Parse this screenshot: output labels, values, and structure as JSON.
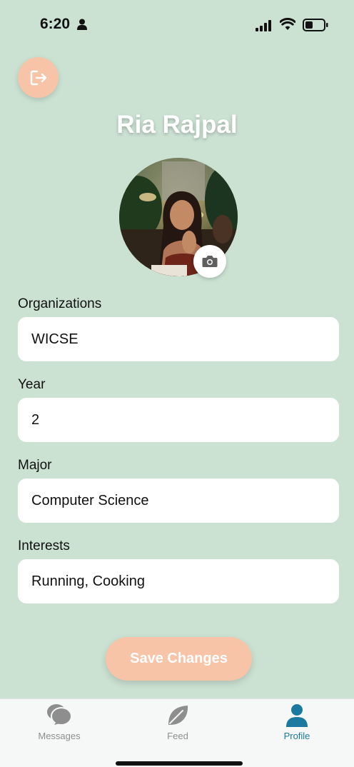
{
  "status_bar": {
    "time": "6:20"
  },
  "profile": {
    "name": "Ria Rajpal"
  },
  "fields": [
    {
      "label": "Organizations",
      "value": "WICSE"
    },
    {
      "label": "Year",
      "value": "2"
    },
    {
      "label": "Major",
      "value": "Computer Science"
    },
    {
      "label": "Interests",
      "value": "Running, Cooking"
    }
  ],
  "save_button": {
    "label": "Save Changes"
  },
  "tabs": [
    {
      "label": "Messages",
      "icon": "chat-bubbles-icon",
      "active": false
    },
    {
      "label": "Feed",
      "icon": "leaf-icon",
      "active": false
    },
    {
      "label": "Profile",
      "icon": "person-icon",
      "active": true
    }
  ],
  "colors": {
    "background": "#cbe2d3",
    "accent_peach": "#f8c4a8",
    "active_tab": "#1c7aa0",
    "inactive_tab": "#8e8e8e"
  }
}
